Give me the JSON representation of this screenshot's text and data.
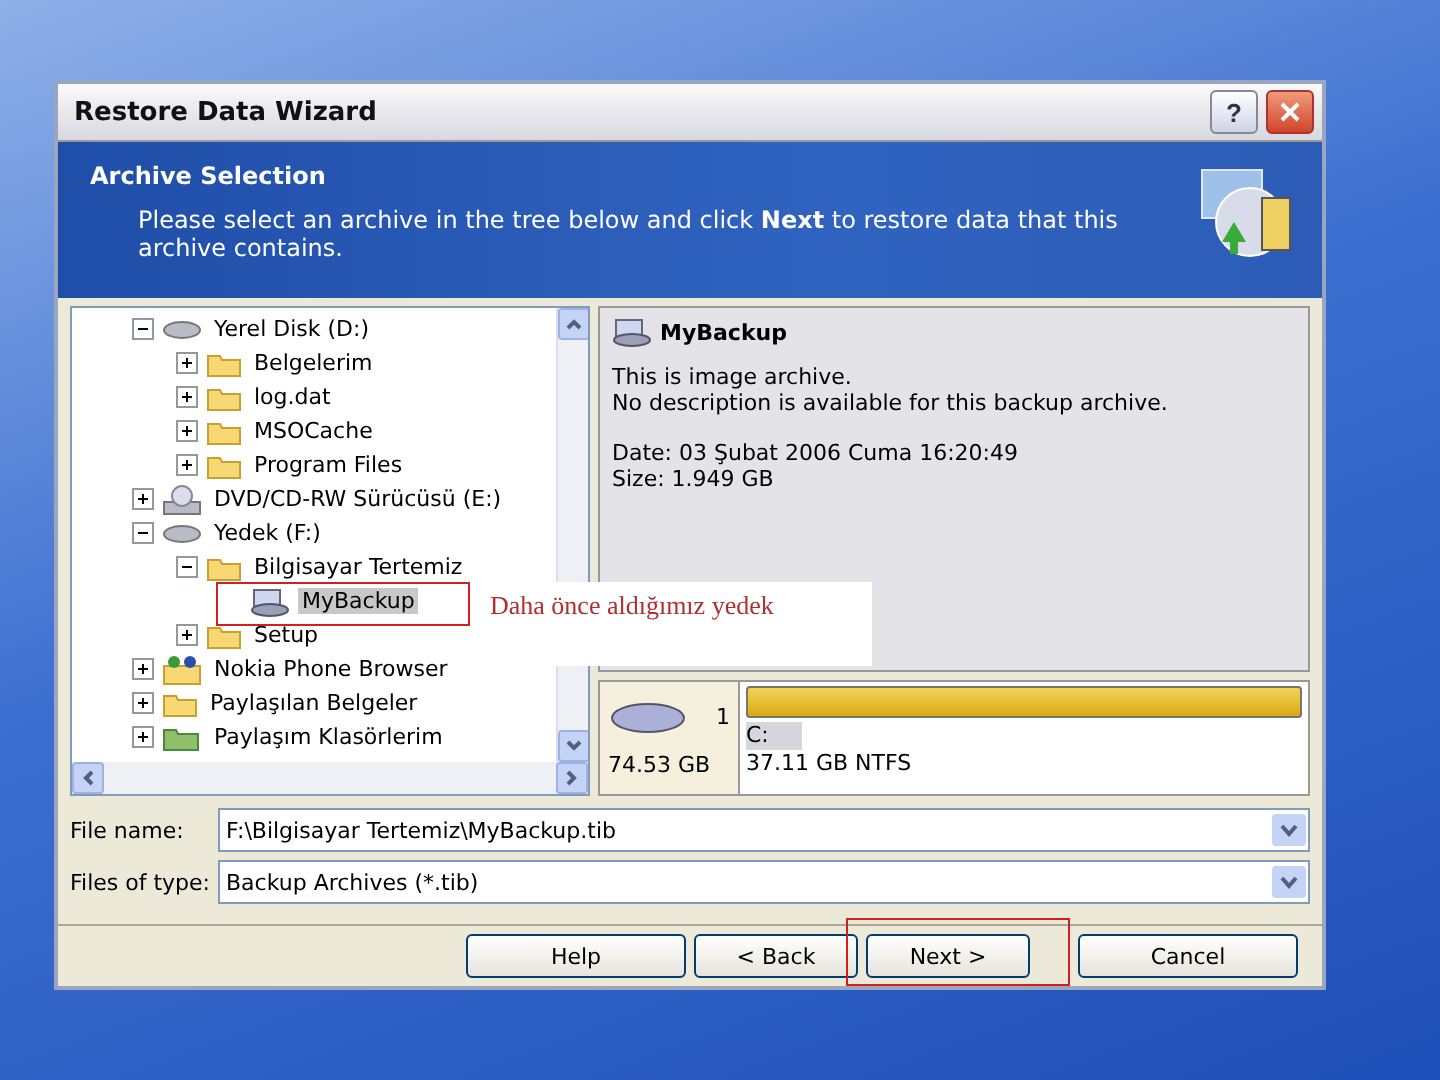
{
  "window": {
    "title": "Restore Data Wizard",
    "help_button": "?"
  },
  "header": {
    "title": "Archive Selection",
    "description": "Please select an archive in the tree below and click **Next** to restore data that this archive contains."
  },
  "tree": [
    {
      "label": "Yerel Disk (D:)",
      "kind": "drive",
      "expanded": true,
      "selected": false,
      "children": [
        {
          "label": "Belgelerim",
          "kind": "folder",
          "expanded": false,
          "selected": false
        },
        {
          "label": "log.dat",
          "kind": "folder",
          "expanded": false,
          "selected": false
        },
        {
          "label": "MSOCache",
          "kind": "folder",
          "expanded": false,
          "selected": false
        },
        {
          "label": "Program Files",
          "kind": "folder",
          "expanded": false,
          "selected": false
        }
      ]
    },
    {
      "label": "DVD/CD-RW Sürücüsü (E:)",
      "kind": "dvd",
      "expanded": false,
      "selected": false
    },
    {
      "label": "Yedek (F:)",
      "kind": "drive",
      "expanded": true,
      "selected": false,
      "children": [
        {
          "label": "Bilgisayar Tertemiz",
          "kind": "folder",
          "expanded": true,
          "selected": false,
          "children": [
            {
              "label": "MyBackup",
              "kind": "backup",
              "selected": true
            }
          ]
        },
        {
          "label": "Setup",
          "kind": "folder",
          "expanded": false,
          "selected": false
        }
      ]
    },
    {
      "label": "Nokia Phone Browser",
      "kind": "phone",
      "expanded": false,
      "selected": false
    },
    {
      "label": "Paylaşılan Belgeler",
      "kind": "folder",
      "expanded": false,
      "selected": false
    },
    {
      "label": "Paylaşım Klasörlerim",
      "kind": "share",
      "expanded": false,
      "selected": false
    }
  ],
  "details": {
    "name": "MyBackup",
    "lines": [
      "This is image archive.",
      "No description is available for this backup archive."
    ],
    "info": [
      "Date: 03 Şubat 2006 Cuma 16:20:49",
      "Size: 1.949 GB"
    ]
  },
  "disk": {
    "number": "1",
    "size": "74.53 GB",
    "partition_label": "C:",
    "partition_info": "37.11 GB  NTFS"
  },
  "fields": [
    {
      "label": "File name:",
      "value": "F:\\Bilgisayar Tertemiz\\MyBackup.tib"
    },
    {
      "label": "Files of type:",
      "value": "Backup Archives (*.tib)"
    }
  ],
  "buttons": [
    "Help",
    "< Back",
    "Next >",
    "Cancel"
  ],
  "annotation": {
    "label": "Daha önce aldığımız yedek"
  }
}
